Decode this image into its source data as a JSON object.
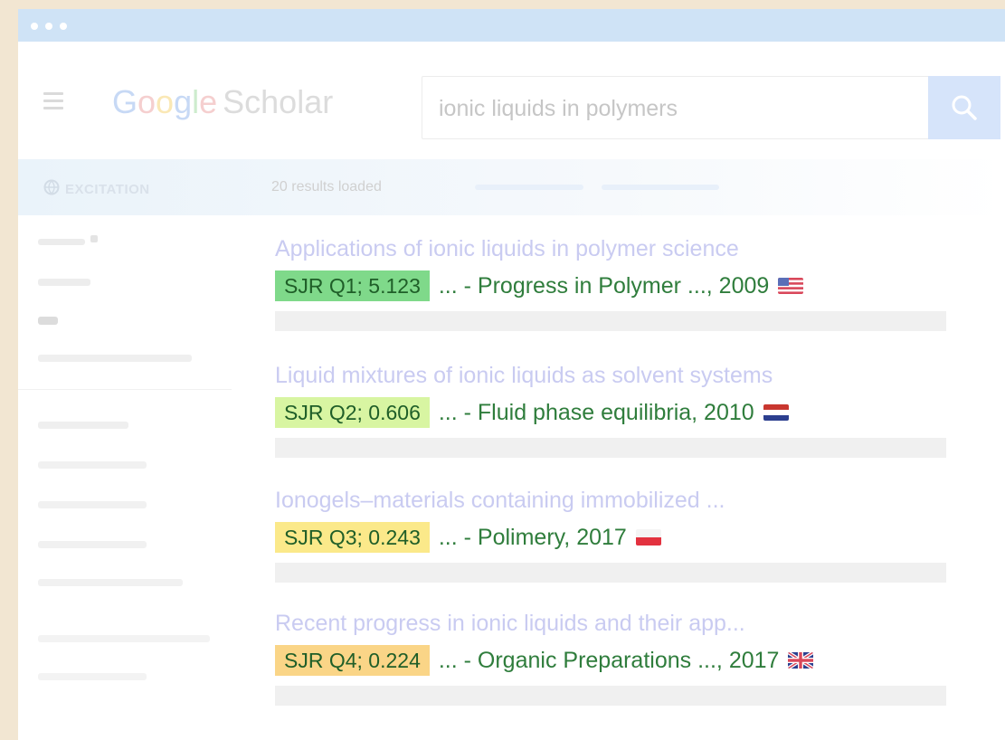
{
  "search": {
    "query": "ionic liquids in polymers",
    "button_icon": "search-icon"
  },
  "logo": {
    "letters": [
      "G",
      "o",
      "o",
      "g",
      "l",
      "e"
    ],
    "word": "Scholar"
  },
  "extension": {
    "label": "EXCITATION",
    "icon": "globe-icon"
  },
  "results_header": {
    "count_text": "20 results loaded"
  },
  "sidebar": {
    "icon": "menu-icon"
  },
  "results": [
    {
      "title": "Applications of ionic liquids  in polymer  science",
      "sjr": "SJR Q1; 5.123",
      "sjr_color": "#7fd98a",
      "source": "... - Progress in Polymer ..., 2009",
      "flag": "us-flag"
    },
    {
      "title": "Liquid mixtures of ionic liquids as solvent systems",
      "sjr": "SJR Q2; 0.606",
      "sjr_color": "#d8f5a2",
      "source": "... - Fluid phase equilibria, 2010",
      "flag": "netherlands-flag"
    },
    {
      "title": "Ionogels–materials containing immobilized ...",
      "sjr": "SJR Q3; 0.243",
      "sjr_color": "#fbe98a",
      "source": "... - Polimery, 2017",
      "flag": "poland-flag"
    },
    {
      "title": "Recent progress in ionic liquids and their app...",
      "sjr": "SJR Q4; 0.224",
      "sjr_color": "#fad587",
      "source": "... - Organic Preparations ..., 2017",
      "flag": "uk-flag"
    }
  ]
}
